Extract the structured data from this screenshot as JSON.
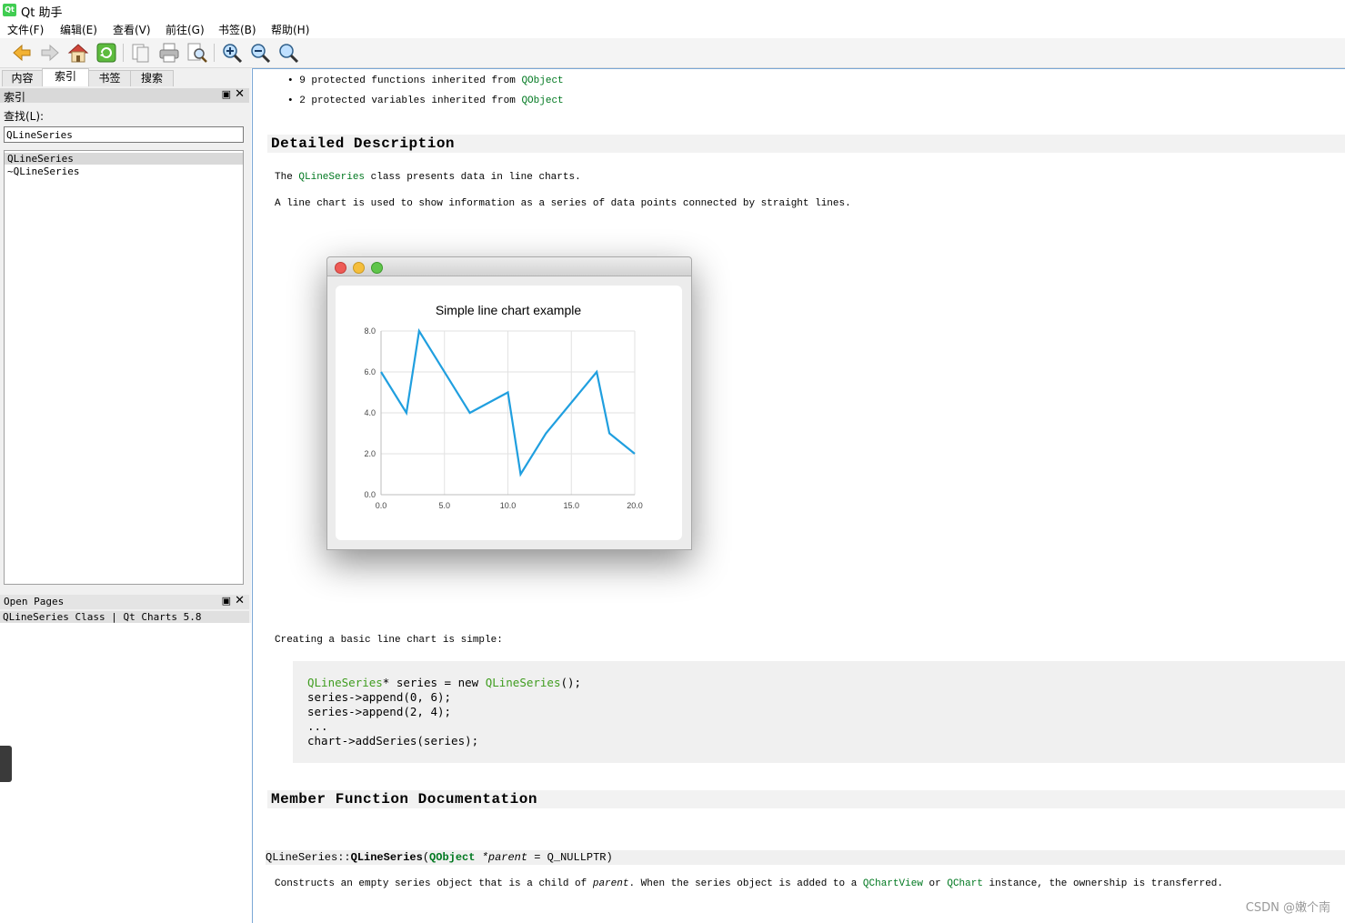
{
  "window": {
    "title": "Qt 助手",
    "app_icon": "Qt"
  },
  "menu": [
    "文件(F)",
    "编辑(E)",
    "查看(V)",
    "前往(G)",
    "书签(B)",
    "帮助(H)"
  ],
  "toolbar": [
    "back-icon",
    "forward-icon",
    "home-icon",
    "sync-icon",
    "copy-icon",
    "print-icon",
    "find-icon",
    "zoom-in-icon",
    "zoom-out-icon",
    "reset-zoom-icon"
  ],
  "left": {
    "tabs": [
      "内容",
      "索引",
      "书签",
      "搜索"
    ],
    "active_tab": "索引",
    "index_header": "索引",
    "find_label": "查找(L):",
    "search_value": "QLineSeries",
    "results": [
      "QLineSeries",
      "~QLineSeries"
    ],
    "open_pages_header": "Open Pages",
    "open_page": "QLineSeries Class | Qt Charts 5.8"
  },
  "doc": {
    "inherited1": {
      "text": "9 protected functions inherited from ",
      "link": "QObject"
    },
    "inherited2": {
      "text": "2 protected variables inherited from ",
      "link": "QObject"
    },
    "h_detail": "Detailed Description",
    "p1_pre": "The ",
    "p1_link": "QLineSeries",
    "p1_post": " class presents data in line charts.",
    "p2": "A line chart is used to show information as a series of data points connected by straight lines.",
    "p3": "Creating a basic line chart is simple:",
    "code": {
      "l1_type": "QLineSeries",
      "l1_mid": "* series = new ",
      "l1_type2": "QLineSeries",
      "l1_end": "();",
      "l2": "series->append(0, 6);",
      "l3": "series->append(2, 4);",
      "l4": "...",
      "l5": "chart->addSeries(series);"
    },
    "h_member": "Member Function Documentation",
    "sig": {
      "class": "QLineSeries::",
      "name": "QLineSeries",
      "open": "(",
      "ptype": "QObject",
      "param": " *parent",
      "rest": " = Q_NULLPTR)"
    },
    "desc_pre": "Constructs an empty series object that is a child of ",
    "desc_em": "parent",
    "desc_mid": ". When the series object is added to a ",
    "desc_link1": "QChartView",
    "desc_or": " or ",
    "desc_link2": "QChart",
    "desc_post": " instance, the ownership is transferred."
  },
  "chart_data": {
    "type": "line",
    "title": "Simple line chart example",
    "x": [
      0,
      2,
      3,
      7,
      10,
      11,
      13,
      17,
      18,
      20
    ],
    "series": [
      {
        "values": [
          6,
          4,
          8,
          4,
          5,
          1,
          3,
          6,
          3,
          2
        ]
      }
    ],
    "xlim": [
      0,
      20
    ],
    "ylim": [
      0,
      8
    ],
    "x_ticks": [
      "0.0",
      "5.0",
      "10.0",
      "15.0",
      "20.0"
    ],
    "y_ticks": [
      "0.0",
      "2.0",
      "4.0",
      "6.0",
      "8.0"
    ],
    "grid": true,
    "line_color": "#209fdf"
  },
  "watermark": "CSDN @嫩个南"
}
